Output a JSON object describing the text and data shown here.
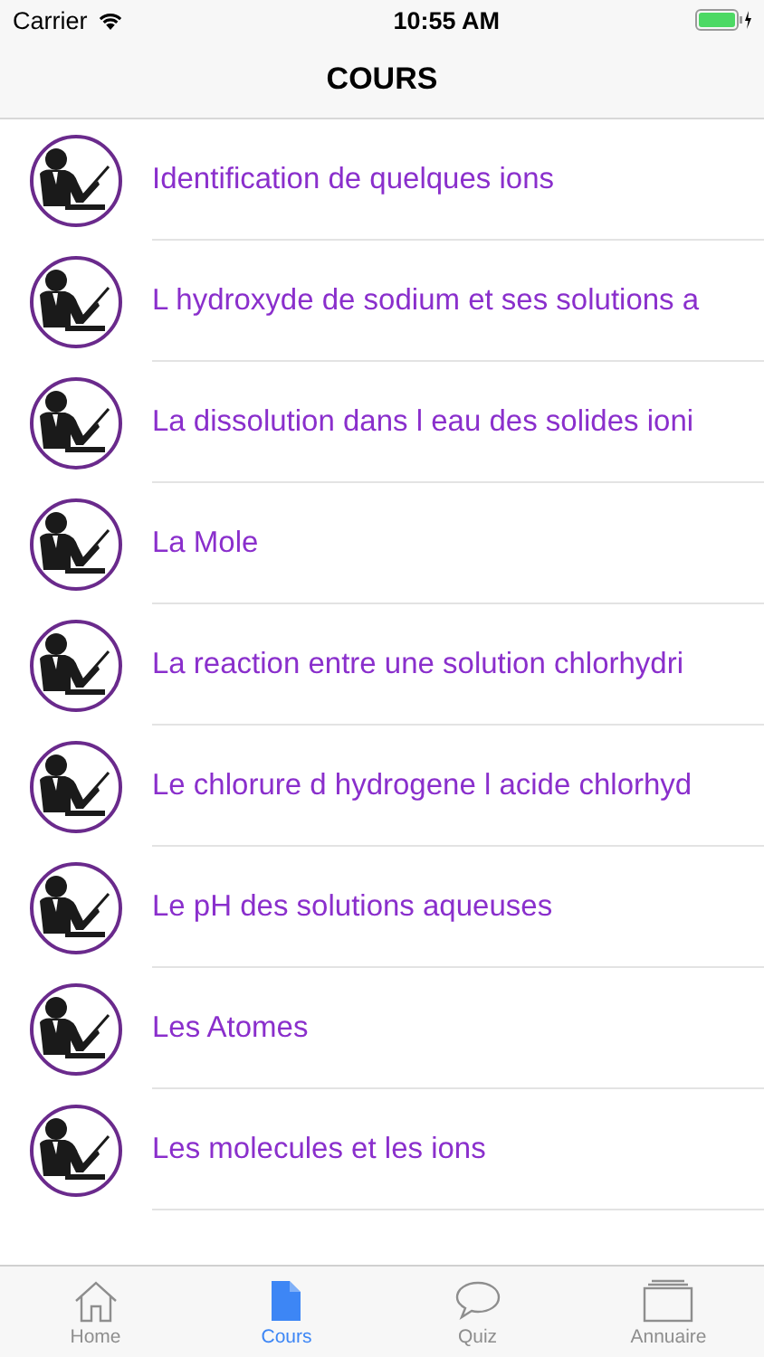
{
  "status_bar": {
    "carrier": "Carrier",
    "time": "10:55 AM"
  },
  "nav_bar": {
    "title": "COURS"
  },
  "courses": [
    {
      "title": "Identification de quelques ions"
    },
    {
      "title": "L hydroxyde de sodium et ses solutions a"
    },
    {
      "title": "La dissolution dans l eau des solides ioni"
    },
    {
      "title": "La Mole"
    },
    {
      "title": "La reaction entre une solution chlorhydri"
    },
    {
      "title": "Le chlorure d hydrogene l acide chlorhyd"
    },
    {
      "title": "Le pH des solutions aqueuses"
    },
    {
      "title": "Les Atomes"
    },
    {
      "title": "Les molecules et les ions"
    }
  ],
  "tab_bar": [
    {
      "label": "Home",
      "kind": "home",
      "selected": false
    },
    {
      "label": "Cours",
      "kind": "doc",
      "selected": true
    },
    {
      "label": "Quiz",
      "kind": "chat",
      "selected": false
    },
    {
      "label": "Annuaire",
      "kind": "stack",
      "selected": false
    }
  ]
}
